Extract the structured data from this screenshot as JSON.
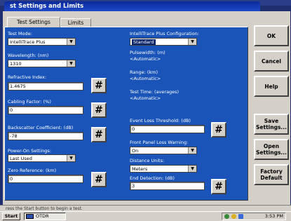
{
  "window": {
    "title": "st Settings and Limits"
  },
  "tabs": [
    {
      "label": "Test Settings"
    },
    {
      "label": "Limits"
    }
  ],
  "left": {
    "test_mode": {
      "label": "Test Mode:",
      "value": "IntelliTrace Plus"
    },
    "wavelength": {
      "label": "Wavelength: (nm)",
      "value": "1310"
    },
    "refractive_index": {
      "label": "Refractive Index:",
      "value": "1.4675"
    },
    "cabling_factor": {
      "label": "Cabling Factor: (%)",
      "value": "0"
    },
    "backscatter": {
      "label": "Backscatter Coefficient: (dB)",
      "value": "-78"
    },
    "power_on": {
      "label": "Power-On Settings:",
      "value": "Last Used"
    },
    "zero_reference": {
      "label": "Zero Reference: (km)",
      "value": "0"
    }
  },
  "right": {
    "config": {
      "label": "IntelliTrace Plus Configuration:",
      "value": "Standard"
    },
    "pulsewidth": {
      "label": "Pulsewidth: (m)",
      "value": "<Automatic>"
    },
    "range": {
      "label": "Range: (km)",
      "value": "<Automatic>"
    },
    "test_time": {
      "label": "Test Time: (averages)",
      "value": "<Automatic>"
    },
    "event_loss": {
      "label": "Event Loss Threshold: (dB)",
      "value": "0"
    },
    "front_panel": {
      "label": "Front Panel Loss Warning:",
      "value": "On"
    },
    "distance_units": {
      "label": "Distance Units:",
      "value": "Meters"
    },
    "end_detection": {
      "label": "End Detection: (dB)",
      "value": "3"
    }
  },
  "keypad_symbol": "#",
  "buttons": {
    "ok": "OK",
    "cancel": "Cancel",
    "help": "Help",
    "save_line1": "Save",
    "save_line2": "Settings...",
    "open_line1": "Open",
    "open_line2": "Settings...",
    "factory_line1": "Factory",
    "factory_line2": "Default"
  },
  "status_message": "ress the Start button to begin a test.",
  "taskbar": {
    "start": "Start",
    "task": "OTDR",
    "clock": "3:53 PM"
  },
  "colors": {
    "panel": "#1a54b8",
    "title_bar": "#0a2a9a",
    "chrome": "#d4d0c8"
  }
}
